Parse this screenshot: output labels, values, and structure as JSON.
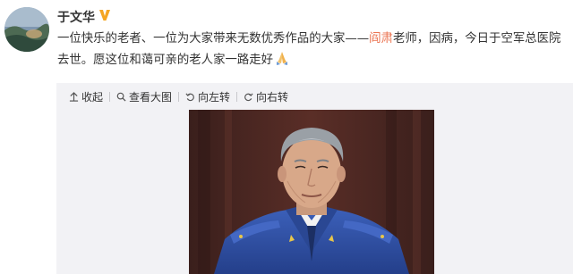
{
  "post": {
    "username": "于文华",
    "text_before": "一位快乐的老者、一位为大家带来无数优秀作品的大家——",
    "mention": "阎肃",
    "text_after": "老师，因病，今日于空军总医院去世。愿这位和蔼可亲的老人家一路走好",
    "verified_icon": "verified-v-icon",
    "emoji_icon": "praying-hands-emoji"
  },
  "toolbar": {
    "collapse_label": "收起",
    "view_large_label": "查看大图",
    "rotate_left_label": "向左转",
    "rotate_right_label": "向右转"
  },
  "colors": {
    "mention": "#eb7350",
    "verified": "#f5a623",
    "panel_bg": "#f2f2f5",
    "uniform": "#2d4fa3"
  }
}
